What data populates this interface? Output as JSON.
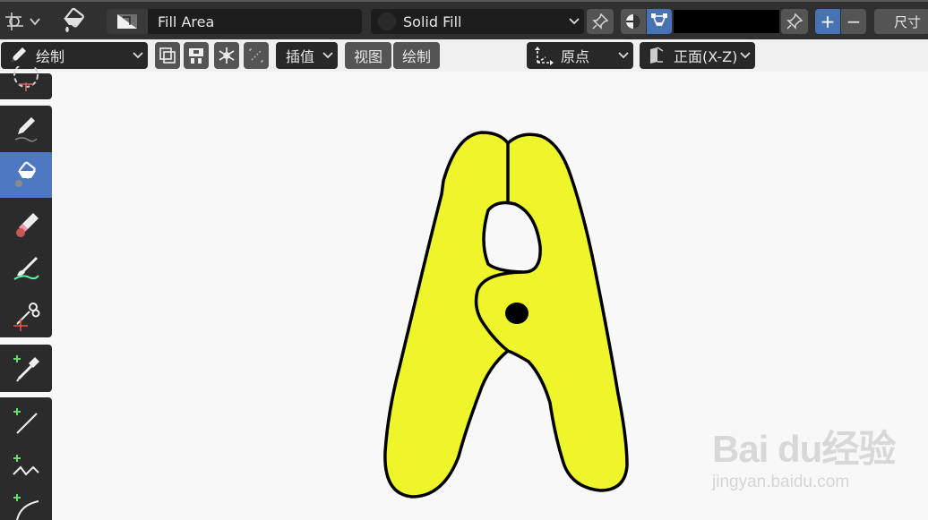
{
  "header": {
    "editor_type_icon": "grease-pencil-icon",
    "fill_tool_icon": "paint-bucket-icon",
    "material_name": "Fill Area",
    "fill_mode": "Solid Fill",
    "color_value": "#000000",
    "size_label": "尺寸",
    "plus_label": "+",
    "minus_label": "−"
  },
  "tool_settings": {
    "mode": "绘制",
    "interpolate_label": "插值",
    "menus": [
      "视图",
      "绘制"
    ],
    "origin": "原点",
    "orientation": "正面(X-Z)"
  },
  "toolbar": {
    "tools": [
      {
        "name": "cursor",
        "icon": "cursor-icon",
        "active": false
      },
      {
        "name": "draw",
        "icon": "pencil-icon",
        "active": false
      },
      {
        "name": "fill",
        "icon": "paint-bucket-icon",
        "active": true
      },
      {
        "name": "erase",
        "icon": "eraser-icon",
        "active": false
      },
      {
        "name": "tint",
        "icon": "brush-icon",
        "active": false
      },
      {
        "name": "cutter",
        "icon": "scissors-icon",
        "active": false
      },
      {
        "name": "eyedropper",
        "icon": "eyedropper-icon",
        "active": false
      },
      {
        "name": "line",
        "icon": "line-icon",
        "active": false
      },
      {
        "name": "polyline",
        "icon": "polyline-icon",
        "active": false
      },
      {
        "name": "arc",
        "icon": "arc-icon",
        "active": false
      }
    ]
  },
  "canvas": {
    "fill_color": "#eef52a",
    "stroke_color": "#000000",
    "background": "#f8f8f8"
  },
  "watermark": {
    "main": "Bai du经验",
    "sub": "jingyan.baidu.com"
  },
  "colors": {
    "accent": "#4772b3",
    "active_tool": "#4f78c2",
    "header_bg": "#303030"
  }
}
